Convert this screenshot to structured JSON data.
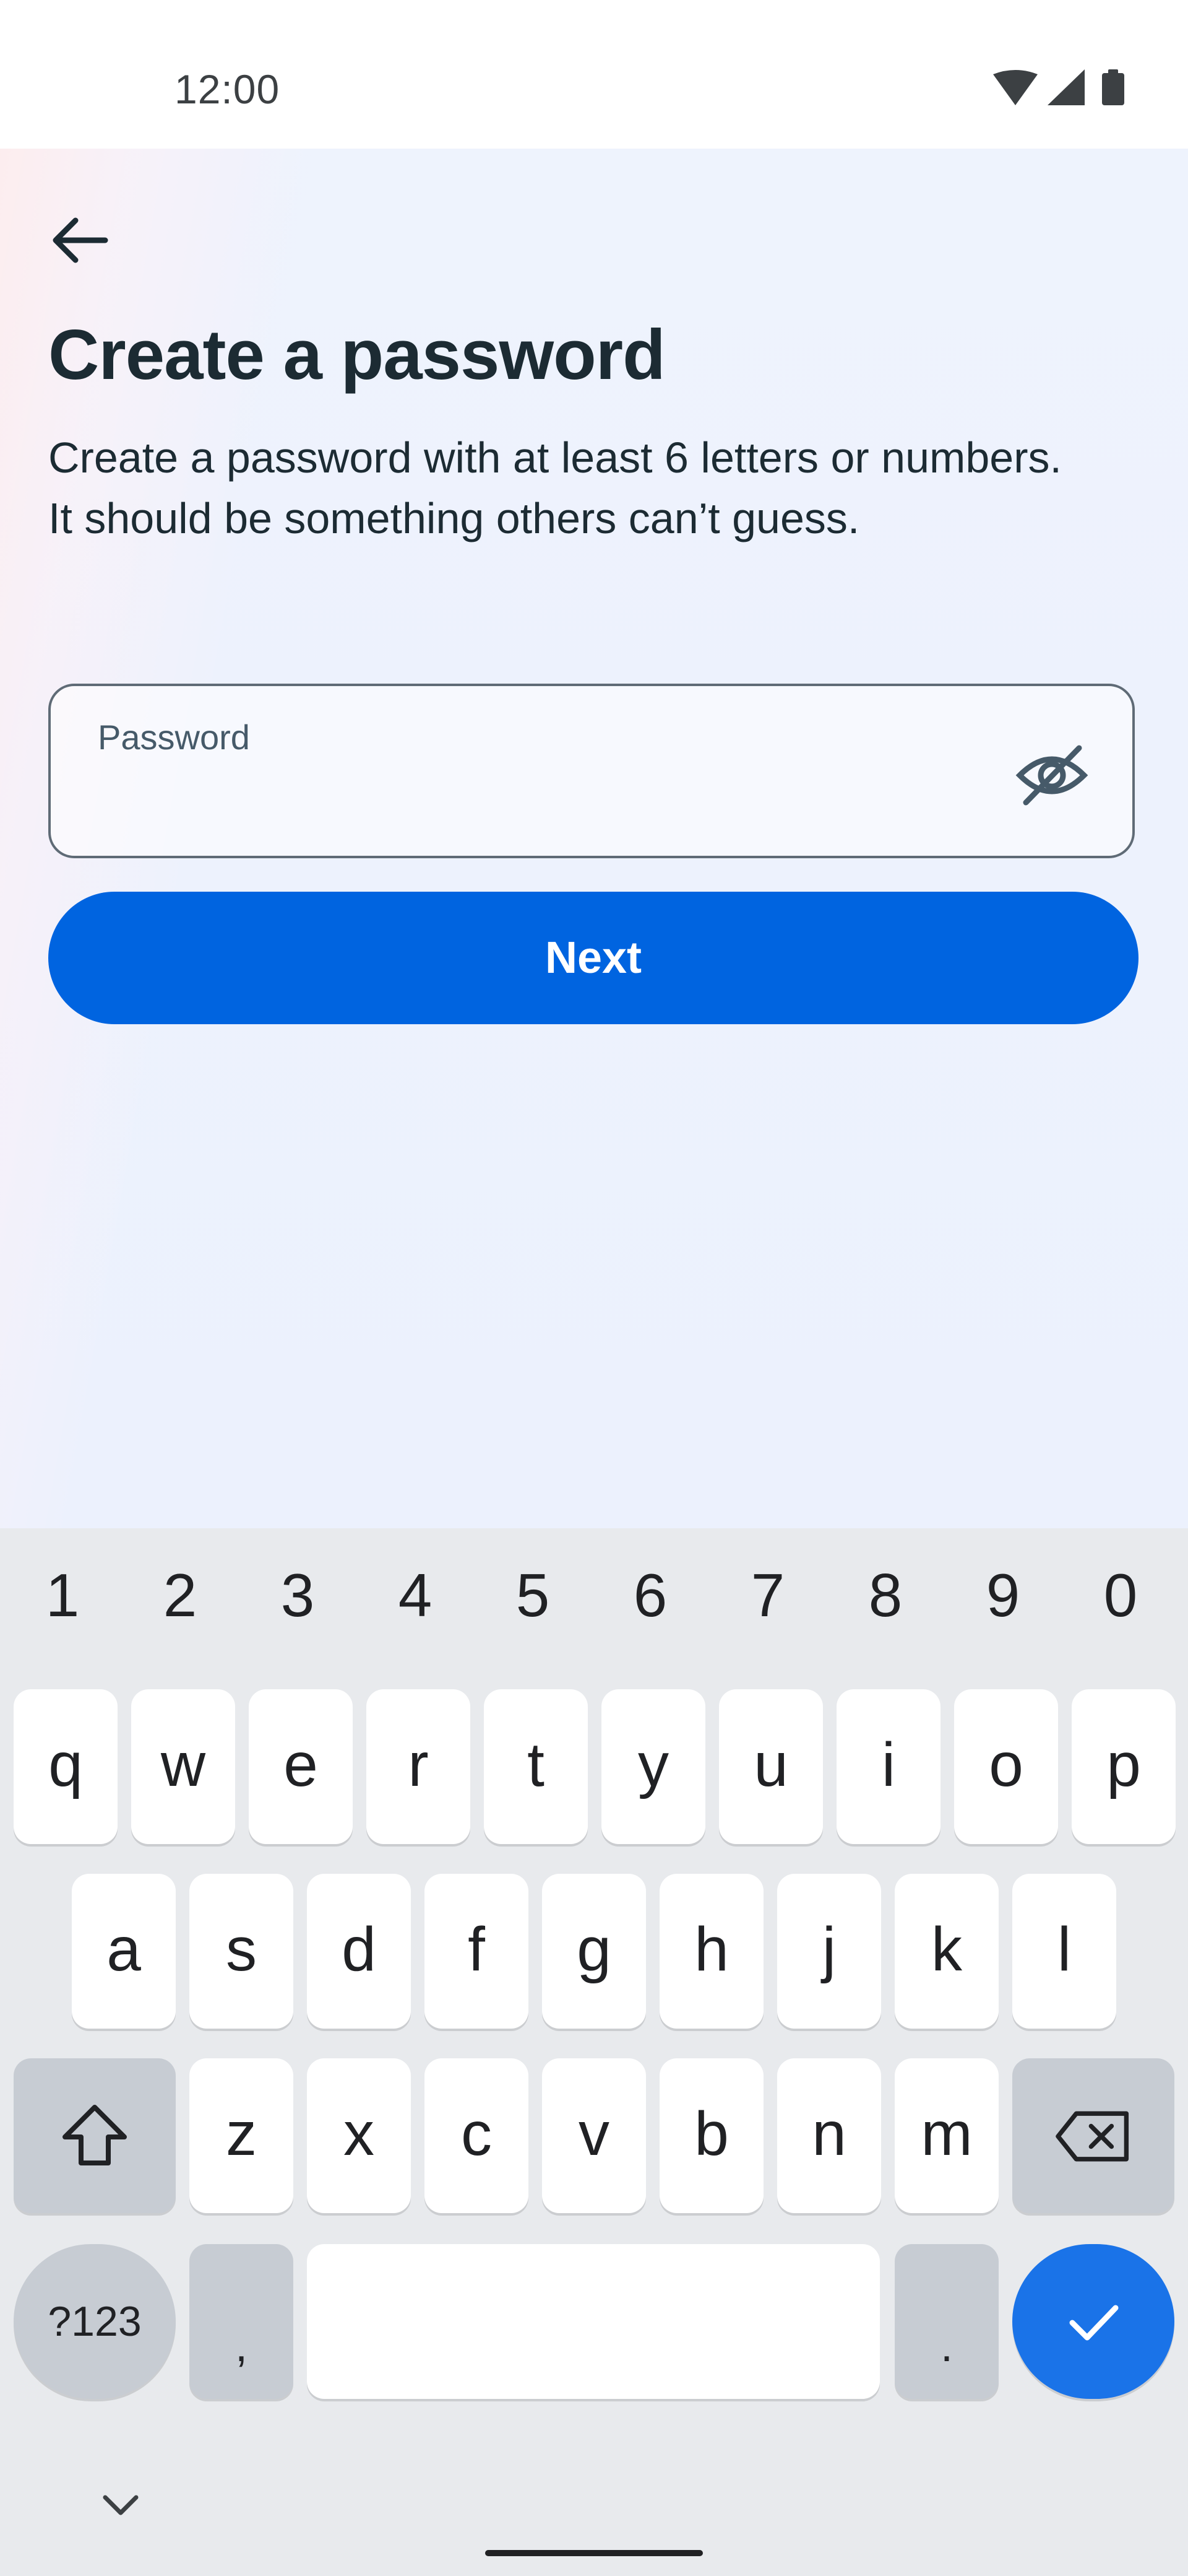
{
  "status_bar": {
    "time": "12:00",
    "icons": [
      "wifi-icon",
      "signal-icon",
      "battery-icon"
    ]
  },
  "header": {
    "back_icon": "arrow-left-icon",
    "title": "Create a password",
    "subtitle": "Create a password with at least 6 letters or numbers. It should be something others can’t guess."
  },
  "password_field": {
    "label": "Password",
    "value": "",
    "toggle_icon": "eye-off-icon"
  },
  "next_button": {
    "label": "Next"
  },
  "keyboard": {
    "numbers": [
      "1",
      "2",
      "3",
      "4",
      "5",
      "6",
      "7",
      "8",
      "9",
      "0"
    ],
    "row1": [
      "q",
      "w",
      "e",
      "r",
      "t",
      "y",
      "u",
      "i",
      "o",
      "p"
    ],
    "row2": [
      "a",
      "s",
      "d",
      "f",
      "g",
      "h",
      "j",
      "k",
      "l"
    ],
    "row3": [
      "z",
      "x",
      "c",
      "v",
      "b",
      "n",
      "m"
    ],
    "symbols_key": "?123",
    "comma_key": ",",
    "period_key": ".",
    "shift_icon": "shift-icon",
    "backspace_icon": "backspace-icon",
    "enter_icon": "check-icon",
    "hide_icon": "chevron-down-icon"
  },
  "colors": {
    "primary": "#0064e0",
    "enter_key": "#1a73e8",
    "text": "#1c2b33"
  }
}
